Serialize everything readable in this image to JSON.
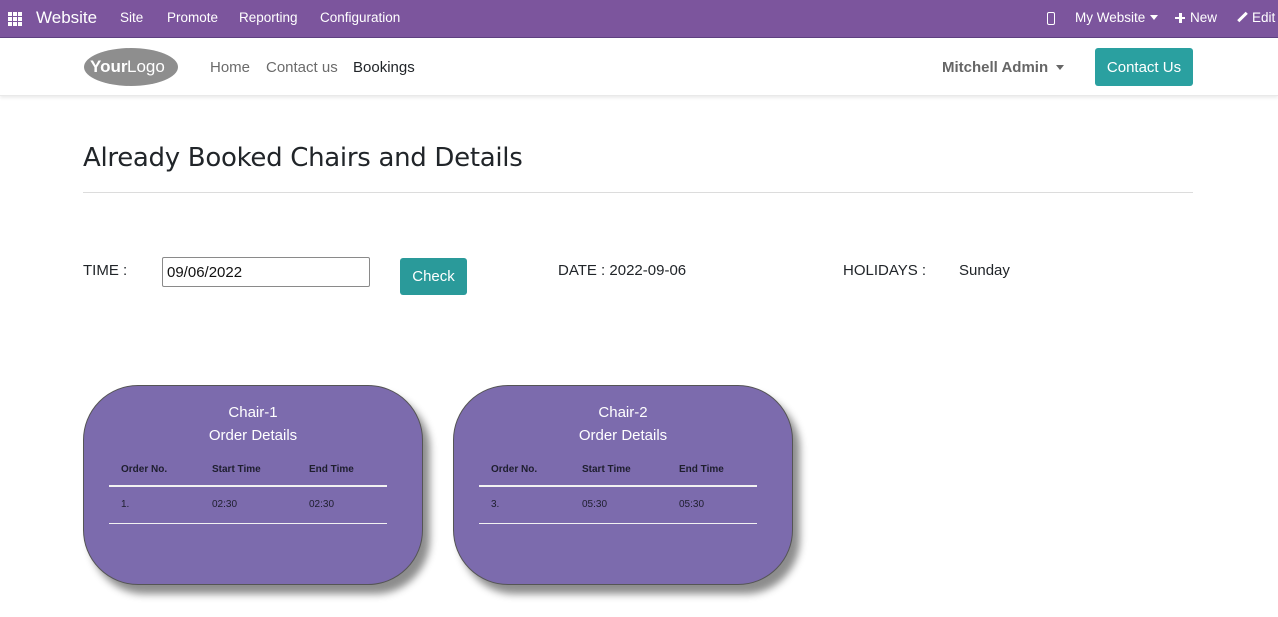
{
  "topbar": {
    "brand": "Website",
    "menu": [
      "Site",
      "Promote",
      "Reporting",
      "Configuration"
    ],
    "my_website": "My Website",
    "new_label": "New",
    "edit_label": "Edit"
  },
  "header": {
    "logo_text_bold": "Your",
    "logo_text_light": "Logo",
    "nav": [
      "Home",
      "Contact us",
      "Bookings"
    ],
    "user": "Mitchell Admin",
    "contact_button": "Contact Us"
  },
  "main": {
    "title": "Already Booked Chairs and Details",
    "time_label": "TIME :",
    "date_input_value": "09/06/2022",
    "check_button": "Check",
    "date_text": "DATE : 2022-09-06",
    "holidays_label": "HOLIDAYS :",
    "holidays_value": "Sunday"
  },
  "cards": [
    {
      "chair": "Chair-1",
      "subtitle": "Order Details",
      "columns": [
        "Order No.",
        "Start Time",
        "End Time"
      ],
      "rows": [
        [
          "1.",
          "02:30",
          "02:30"
        ]
      ]
    },
    {
      "chair": "Chair-2",
      "subtitle": "Order Details",
      "columns": [
        "Order No.",
        "Start Time",
        "End Time"
      ],
      "rows": [
        [
          "3.",
          "05:30",
          "05:30"
        ]
      ]
    }
  ],
  "colors": {
    "topbar": "#7c559d",
    "accent_teal": "#2aa0a0",
    "card_purple": "#7c6bad"
  }
}
